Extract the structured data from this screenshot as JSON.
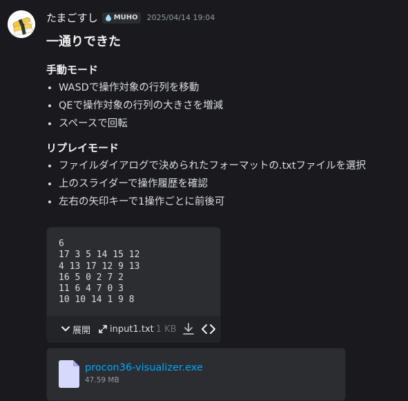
{
  "message": {
    "author": "たまごすし",
    "guild_tag": "MUHO",
    "timestamp": "2025/04/14 19:04",
    "heading": "一通りできた",
    "sections": [
      {
        "title": "手動モード",
        "items": [
          "WASDで操作対象の行列を移動",
          "QEで操作対象の行列の大きさを増減",
          "スペースで回転"
        ]
      },
      {
        "title": "リプレイモード",
        "items": [
          "ファイルダイアログで決められたフォーマットの.txtファイルを選択",
          "上のスライダーで操作履歴を確認",
          "左右の矢印キーで1操作ごとに前後可"
        ]
      }
    ]
  },
  "code_attachment": {
    "content": "6\n17 3 5 14 15 12\n4 13 17 12 9 13\n16 5 0 2 7 2\n11 6 4 7 0 3\n10 10 14 1 9 8",
    "expand_label": "展開",
    "file_name": "input1.txt",
    "file_size": "1 KB"
  },
  "file_attachment": {
    "file_name": "procon36-visualizer.exe",
    "file_size": "47.59 MB"
  },
  "colors": {
    "background": "#1a1a1e",
    "link": "#00a8fc",
    "file_icon": "#d7d9fc"
  },
  "icons": [
    "avatar-sushi",
    "droplet-icon",
    "chevron-down-icon",
    "expand-arrows-icon",
    "download-icon",
    "code-icon",
    "file-icon"
  ]
}
